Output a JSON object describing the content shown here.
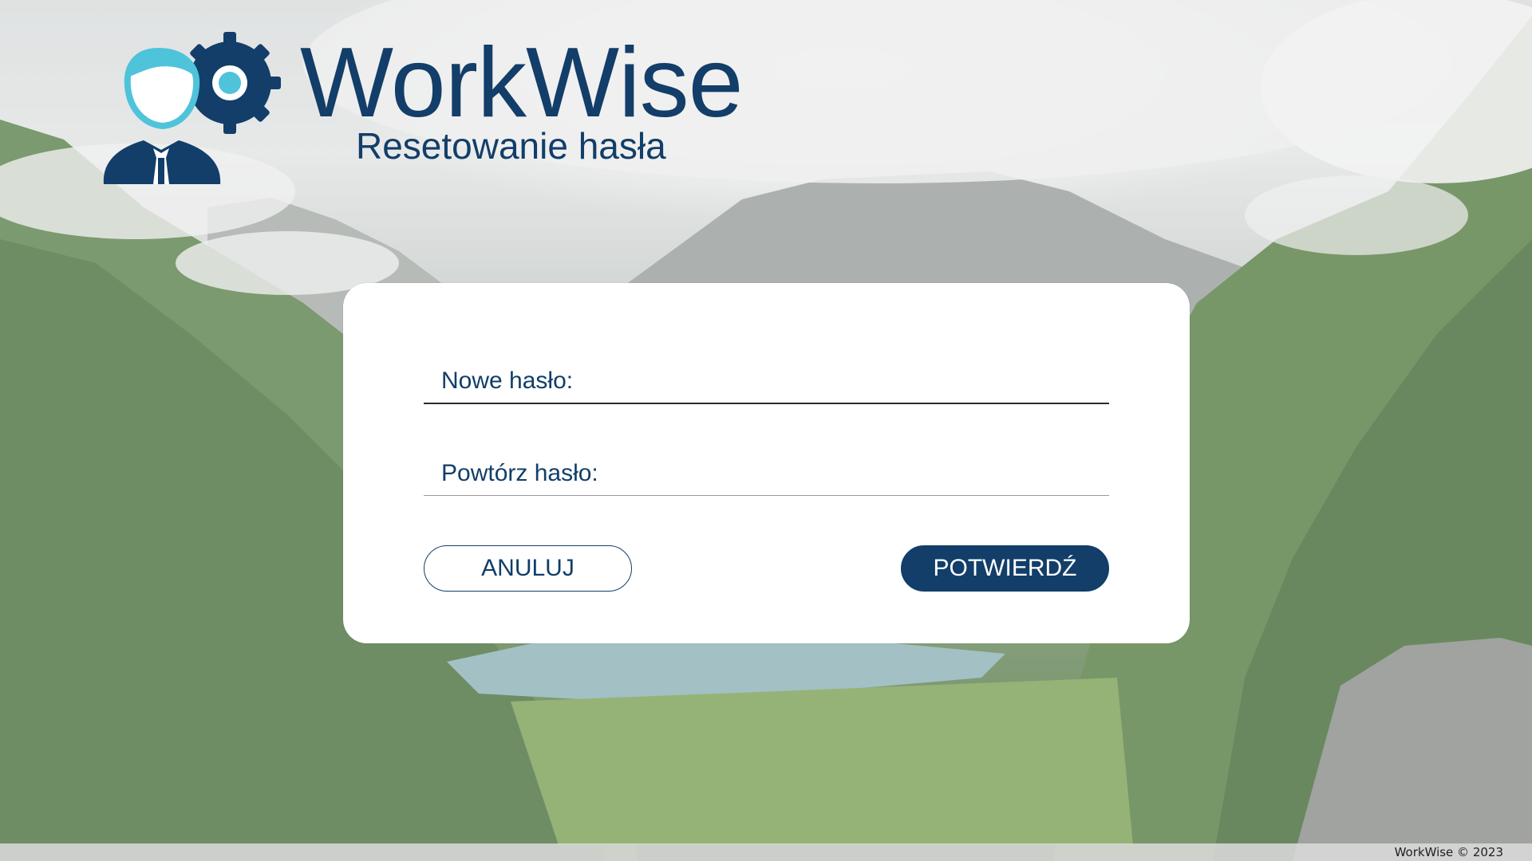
{
  "brand": {
    "name": "WorkWise",
    "subtitle": "Resetowanie hasła"
  },
  "form": {
    "new_password": {
      "label": "Nowe hasło:",
      "value": "",
      "placeholder": ""
    },
    "repeat_password": {
      "label": "Powtórz hasło:",
      "value": "",
      "placeholder": ""
    },
    "cancel_label": "ANULUJ",
    "confirm_label": "POTWIERDŹ"
  },
  "footer": {
    "copyright": "WorkWise © 2023"
  },
  "colors": {
    "primary": "#123e69",
    "accent": "#4fc3d9",
    "card": "#ffffff"
  },
  "icons": {
    "logo": "user-gear-logo-icon"
  }
}
